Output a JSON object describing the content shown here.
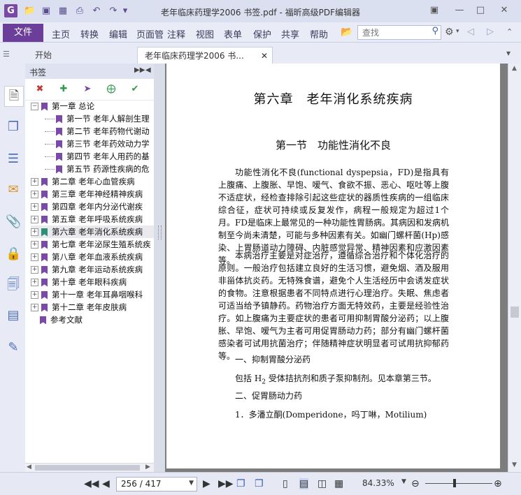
{
  "window": {
    "title": "老年临床药理学2006 书签.pdf - 福昕高级PDF编辑器"
  },
  "ribbon": {
    "file": "文件",
    "menus": [
      "主页",
      "转换",
      "编辑",
      "页面管",
      "注释",
      "视图",
      "表单",
      "保护",
      "共享",
      "帮助"
    ],
    "search_placeholder": "查找"
  },
  "tabs": {
    "start": "开始",
    "doc": "老年临床药理学2006 书..."
  },
  "sidebar": {
    "header": "书签"
  },
  "bookmarks": [
    {
      "label": "第一章 总论",
      "level": 0,
      "expander": "-"
    },
    {
      "label": "第一节 老年人解剖生理",
      "level": 1
    },
    {
      "label": "第二节 老年药物代谢动",
      "level": 1
    },
    {
      "label": "第三节 老年药效动力学",
      "level": 1
    },
    {
      "label": "第四节 老年人用药的基",
      "level": 1
    },
    {
      "label": "第五节 药源性疾病的危",
      "level": 1
    },
    {
      "label": "第二章 老年心血管疾病",
      "level": 0,
      "expander": "+"
    },
    {
      "label": "第三章 老年神经精神疾病",
      "level": 0,
      "expander": "+"
    },
    {
      "label": "第四章 老年内分泌代谢疾",
      "level": 0,
      "expander": "+"
    },
    {
      "label": "第五章 老年呼吸系统疾病",
      "level": 0,
      "expander": "+"
    },
    {
      "label": "第六章 老年消化系统疾病",
      "level": 0,
      "expander": "+",
      "selected": true
    },
    {
      "label": "第七章 老年泌尿生殖系统疾",
      "level": 0,
      "expander": "+"
    },
    {
      "label": "第八章 老年血液系统疾病",
      "level": 0,
      "expander": "+"
    },
    {
      "label": "第九章 老年运动系统疾病",
      "level": 0,
      "expander": "+"
    },
    {
      "label": "第十章 老年眼科疾病",
      "level": 0,
      "expander": "+"
    },
    {
      "label": "第十一章 老年耳鼻咽喉科",
      "level": 0,
      "expander": "+"
    },
    {
      "label": "第十二章 老年皮肤病",
      "level": 0,
      "expander": "+"
    },
    {
      "label": "参考文献",
      "level": 0
    }
  ],
  "pdf": {
    "chapter_title": "第六章　老年消化系统疾病",
    "section_title": "第一节　功能性消化不良",
    "para1": "功能性消化不良(functional dyspepsia，FD)是指具有上腹痛、上腹胀、早饱、嗳气、食欲不振、恶心、呕吐等上腹不适症状，经检查排除引起这些症状的器质性疾病的一组临床综合征，症状可持续或反复发作，病程一般规定为超过1个月。FD是临床上最常见的一种功能性胃肠病。其病因和发病机制至今尚未清楚，可能与多种因素有关。如幽门螺杆菌(Hp)感染、上胃肠道动力障碍、内脏感觉异常、精神因素和应激因素等。",
    "para2": "本病治疗主要是对症治疗，遵循综合治疗和个体化治疗的原则。一般治疗包括建立良好的生活习惯，避免烟、酒及服用非甾体抗炎药。无特殊食谱，避免个人生活经历中会诱发症状的食物。注意根据患者不同特点进行心理治疗。失眠、焦虑者可适当给予镇静药。药物治疗方面无特效药，主要是经验性治疗。如上腹痛为主要症状的患者可用抑制胃酸分泌药；以上腹胀、早饱、嗳气为主者可用促胃肠动力药；部分有幽门螺杆菌感染者可试用抗菌治疗；伴随精神症状明显者可试用抗抑郁药等。",
    "h1": "一、抑制胃酸分泌药",
    "para3_pre": "包括 H",
    "para3_sub": "2",
    "para3_post": " 受体拮抗剂和质子泵抑制剂。见本章第三节。",
    "h2": "二、促胃肠动力药",
    "h3": "1．多潘立酮(Domperidone，吗丁啉，Motilium)"
  },
  "status": {
    "page": "256 / 417",
    "zoom": "84.33%"
  }
}
